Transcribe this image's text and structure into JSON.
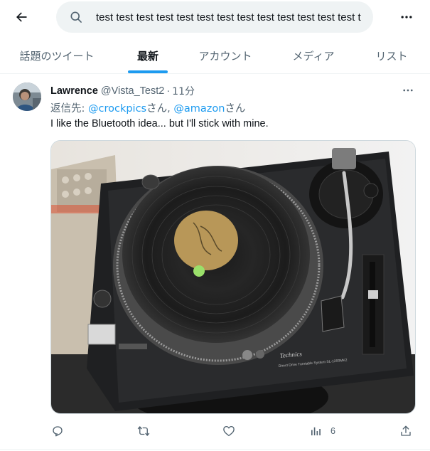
{
  "header": {
    "back_icon": "arrow-left-icon",
    "search": {
      "value": "test test test test test test test test test test test test test t",
      "icon": "search-icon"
    },
    "more_icon": "more-horizontal-icon"
  },
  "tabs": [
    {
      "label": "話題のツイート",
      "active": false
    },
    {
      "label": "最新",
      "active": true
    },
    {
      "label": "アカウント",
      "active": false
    },
    {
      "label": "メディア",
      "active": false
    },
    {
      "label": "リスト",
      "active": false
    }
  ],
  "tweet": {
    "author_name": "Lawrence",
    "handle": "@Vista_Test2",
    "separator": "·",
    "time": "11分",
    "reply_prefix": "返信先: ",
    "reply_to": [
      {
        "handle": "@crockpics",
        "suffix": "さん, "
      },
      {
        "handle": "@amazon",
        "suffix": "さん"
      }
    ],
    "text": "I like the Bluetooth idea... but I'll stick with mine.",
    "media_caption_logo": "Technics",
    "media_model": "Direct Drive Turntable System  SL-1200MK2",
    "actions": {
      "reply_icon": "reply-icon",
      "retweet_icon": "retweet-icon",
      "like_icon": "heart-icon",
      "views_icon": "views-chart-icon",
      "views_count": "6",
      "share_icon": "share-icon"
    }
  },
  "colors": {
    "accent": "#1d9bf0",
    "muted": "#536471",
    "text": "#0f1419",
    "search_bg": "#eff3f4"
  }
}
